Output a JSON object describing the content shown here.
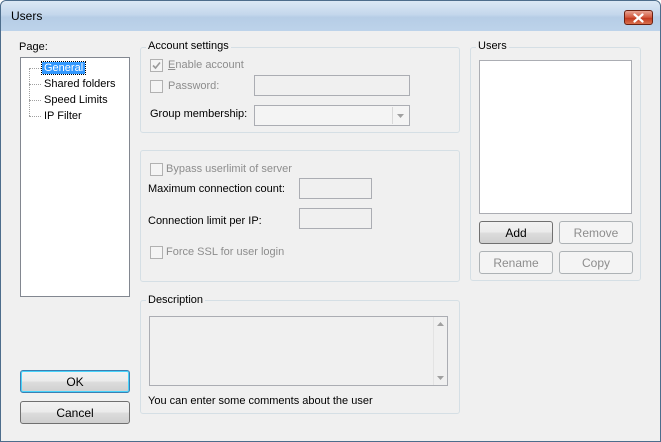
{
  "window": {
    "title": "Users"
  },
  "page_panel": {
    "label": "Page:",
    "items": [
      {
        "label": "General",
        "selected": true
      },
      {
        "label": "Shared folders",
        "selected": false
      },
      {
        "label": "Speed Limits",
        "selected": false
      },
      {
        "label": "IP Filter",
        "selected": false
      }
    ]
  },
  "account_settings": {
    "title": "Account settings",
    "enable_account_label": "Enable account",
    "enable_account_checked": true,
    "password_label": "Password:",
    "password_checked": false,
    "password_value": "",
    "group_membership_label": "Group membership:",
    "group_membership_value": ""
  },
  "connection": {
    "bypass_label": "Bypass userlimit of server",
    "max_conn_label": "Maximum connection count:",
    "max_conn_value": "",
    "limit_per_ip_label": "Connection limit per IP:",
    "limit_per_ip_value": "",
    "force_ssl_label": "Force SSL for user login"
  },
  "description": {
    "title": "Description",
    "value": "",
    "hint": "You can enter some comments about the user"
  },
  "users": {
    "title": "Users",
    "list": [],
    "add_label": "Add",
    "remove_label": "Remove",
    "rename_label": "Rename",
    "copy_label": "Copy"
  },
  "buttons": {
    "ok_label": "OK",
    "cancel_label": "Cancel"
  },
  "colors": {
    "selection": "#3399ff",
    "close_button": "#c2391f",
    "titlebar": "#c4d7ec"
  }
}
